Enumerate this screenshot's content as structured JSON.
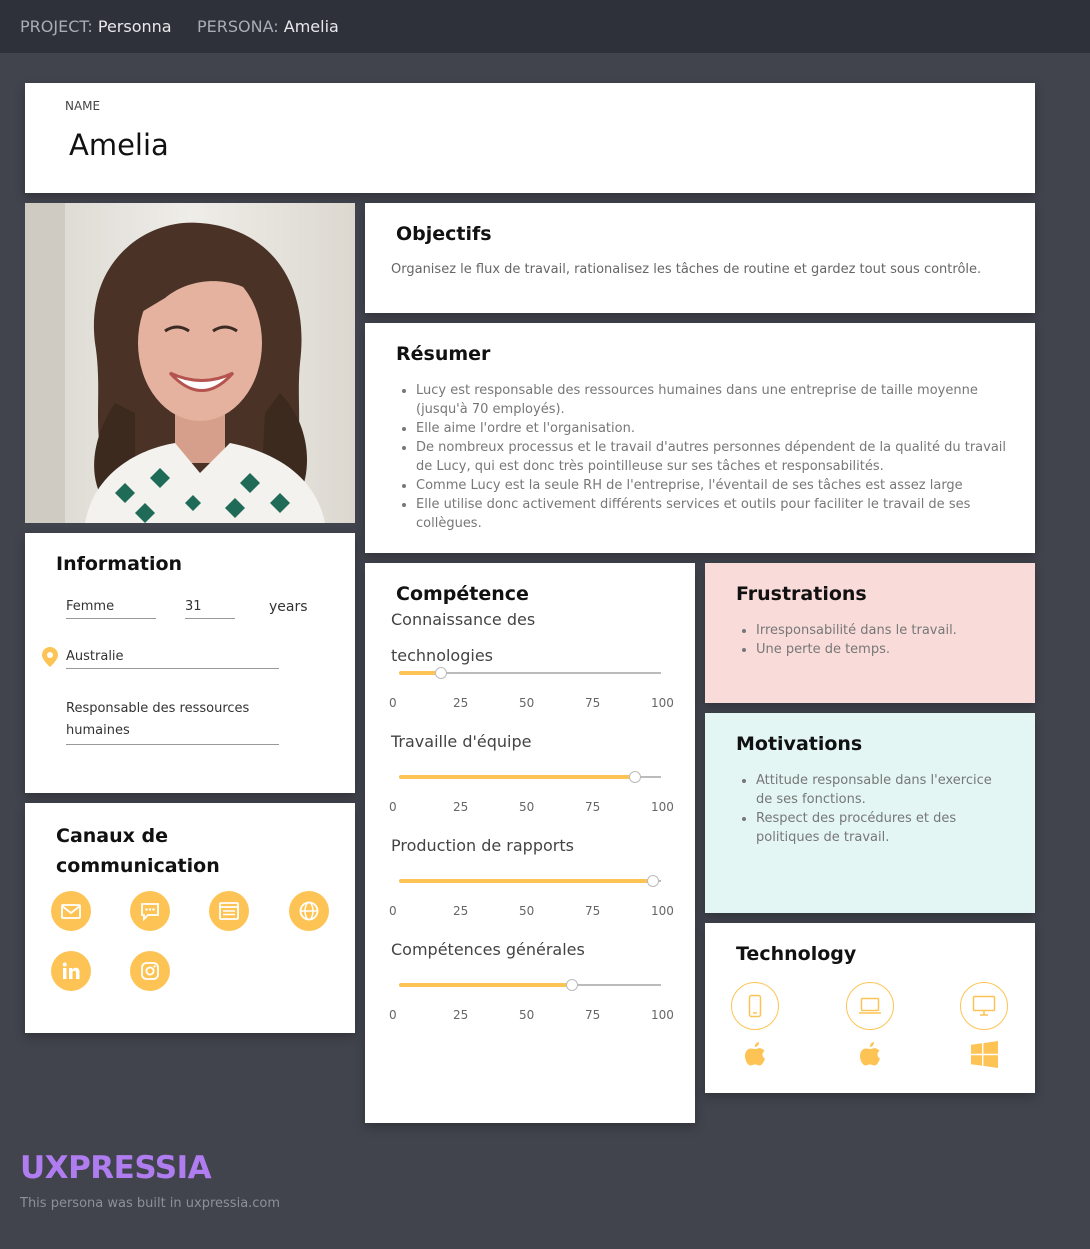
{
  "topbar": {
    "project_label": "PROJECT:",
    "project_value": "Personna",
    "persona_label": "PERSONA:",
    "persona_value": "Amelia"
  },
  "name_card": {
    "label": "NAME",
    "value": "Amelia"
  },
  "information": {
    "title": "Information",
    "gender": "Femme",
    "age": "31",
    "age_unit": "years",
    "location": "Australie",
    "job_line1": "Responsable des ressources",
    "job_line2": "humaines"
  },
  "channels": {
    "title_line1": "Canaux de",
    "title_line2": "communication",
    "icons": [
      "email-icon",
      "chat-icon",
      "browser-icon",
      "globe-icon",
      "linkedin-icon",
      "instagram-icon"
    ]
  },
  "objectifs": {
    "title": "Objectifs",
    "text": "Organisez le flux de travail, rationalisez les tâches de routine et gardez tout sous contrôle."
  },
  "resumer": {
    "title": "Résumer",
    "items": [
      "Lucy est responsable des ressources humaines dans une entreprise de taille moyenne (jusqu'à 70 employés).",
      "Elle aime l'ordre et l'organisation.",
      "De nombreux processus et le travail d'autres personnes dépendent de la qualité du travail de Lucy, qui est donc très pointilleuse sur ses tâches et responsabilités.",
      "Comme Lucy est la seule RH de l'entreprise, l'éventail de ses tâches est assez large",
      "Elle utilise donc activement différents services et outils pour faciliter le travail de ses collègues."
    ]
  },
  "competence": {
    "title": "Compétence",
    "ticks": [
      "0",
      "25",
      "50",
      "75",
      "100"
    ],
    "skills": [
      {
        "label": "Connaissance des technologies",
        "value": 16
      },
      {
        "label": "Travaille d'équipe",
        "value": 90
      },
      {
        "label": "Production de rapports",
        "value": 97
      },
      {
        "label": "Compétences générales",
        "value": 66
      }
    ]
  },
  "frustrations": {
    "title": "Frustrations",
    "items": [
      "Irresponsabilité dans le travail.",
      "Une perte de temps."
    ]
  },
  "motivations": {
    "title": "Motivations",
    "items": [
      "Attitude responsable dans l'exercice de ses fonctions.",
      "Respect des procédures et des politiques de travail."
    ]
  },
  "technology": {
    "title": "Technology",
    "devices": [
      {
        "device": "smartphone-icon",
        "os": "apple-icon"
      },
      {
        "device": "laptop-icon",
        "os": "apple-icon"
      },
      {
        "device": "desktop-icon",
        "os": "windows-icon"
      }
    ]
  },
  "footer": {
    "brand": "UXPRESSIA",
    "note": "This persona was built in uxpressia.com"
  },
  "colors": {
    "accent": "#fdc455",
    "background": "#41444d",
    "topbar": "#2e3139",
    "frustrations_bg": "#f9dcd9",
    "motivations_bg": "#e3f6f3",
    "brand": "#b07df0"
  }
}
